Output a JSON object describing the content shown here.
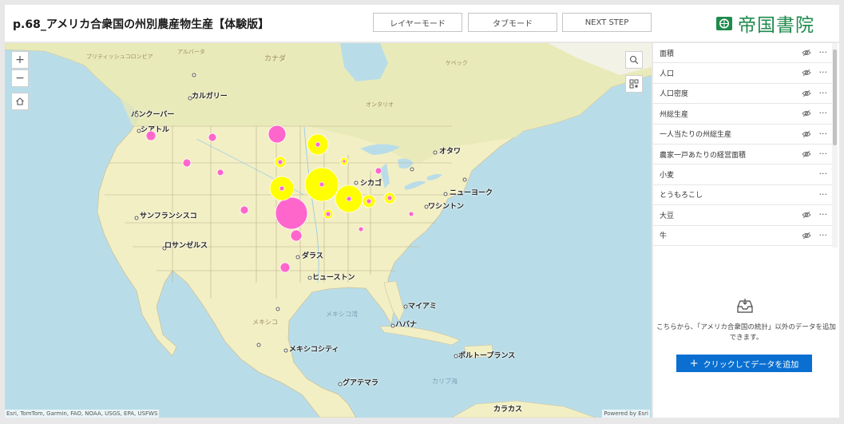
{
  "header": {
    "title": "p.68_アメリカ合衆国の州別農産物生産【体験版】",
    "buttons": [
      "レイヤーモード",
      "タブモード",
      "NEXT STEP"
    ],
    "logo_text": "帝国書院",
    "logo_color": "#1f8a4c"
  },
  "map": {
    "controls": {
      "zoom_in": "+",
      "zoom_out": "−"
    },
    "country_labels": [
      "カナダ",
      "メキシコ",
      "ケベック",
      "オンタリオ",
      "アルバータ",
      "ブリティッシュコロンビア"
    ],
    "city_labels": [
      "バンクーバー",
      "シアトル",
      "カルガリー",
      "サンフランシスコ",
      "ロサンゼルス",
      "ダラス",
      "ヒューストン",
      "シカゴ",
      "オタワ",
      "ニューヨーク",
      "ワシントン",
      "マイアミ",
      "ハバナ",
      "メキシコシティ",
      "グアテマラ",
      "ポルトープランス",
      "カラカス"
    ],
    "sea_labels": [
      "メキシコ湾",
      "カリブ海"
    ],
    "attribution": "Esri, TomTom, Garmin, FAO, NOAA, USGS, EPA, USFWS",
    "powered_by": "Powered by Esri",
    "colors": {
      "soybean": "#ffff00",
      "cattle": "#ff66cc"
    }
  },
  "layers": [
    {
      "name": "面積",
      "visibility_toggle": true
    },
    {
      "name": "人口",
      "visibility_toggle": true
    },
    {
      "name": "人口密度",
      "visibility_toggle": true
    },
    {
      "name": "州総生産",
      "visibility_toggle": true
    },
    {
      "name": "一人当たりの州総生産",
      "visibility_toggle": true
    },
    {
      "name": "農家一戸あたりの経営面積",
      "visibility_toggle": true
    },
    {
      "name": "小麦",
      "visibility_toggle": false
    },
    {
      "name": "とうもろこし",
      "visibility_toggle": false
    },
    {
      "name": "大豆",
      "visibility_toggle": true
    },
    {
      "name": "牛",
      "visibility_toggle": true
    }
  ],
  "add_data": {
    "message": "こちらから、「アメリカ合衆国の統計」以外のデータを追加できます。",
    "button_label": "クリックしてデータを追加"
  }
}
